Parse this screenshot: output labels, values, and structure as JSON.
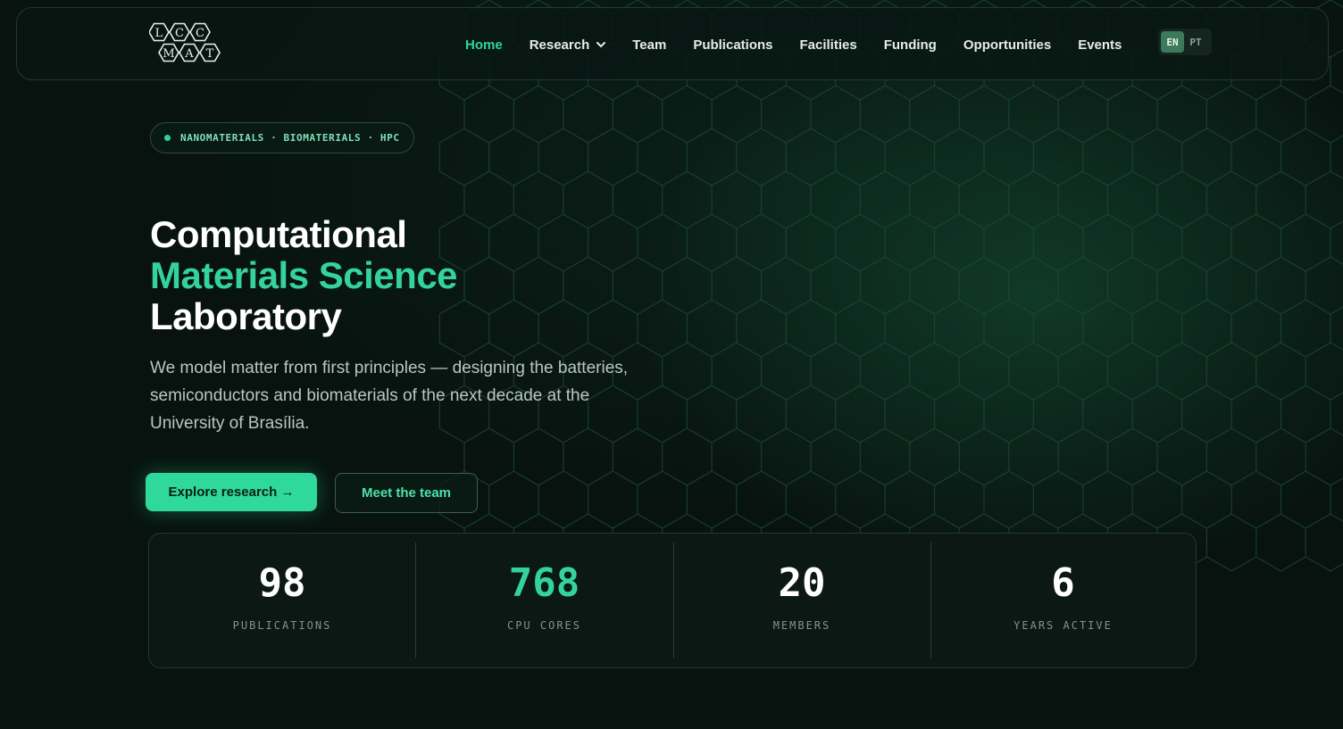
{
  "nav": {
    "logo_letters": [
      "L",
      "C",
      "C",
      "M",
      "A",
      "T"
    ],
    "links": [
      {
        "label": "Home",
        "active": true
      },
      {
        "label": "Research",
        "has_dropdown": true
      },
      {
        "label": "Team"
      },
      {
        "label": "Publications"
      },
      {
        "label": "Facilities"
      },
      {
        "label": "Funding"
      },
      {
        "label": "Opportunities"
      },
      {
        "label": "Events"
      }
    ],
    "languages": [
      {
        "code": "EN",
        "selected": true
      },
      {
        "code": "PT",
        "selected": false
      }
    ]
  },
  "hero": {
    "tags": "NANOMATERIALS · BIOMATERIALS · HPC",
    "title_line1": "Computational",
    "title_line2": "Materials Science",
    "title_line3": "Laboratory",
    "description": "We model matter from first principles — designing the batteries, semiconductors and biomaterials of the next decade at the University of Brasília.",
    "primary_button": "Explore research →",
    "secondary_button": "Meet the team"
  },
  "stats": [
    {
      "value": "98",
      "label": "PUBLICATIONS",
      "accent": false
    },
    {
      "value": "768",
      "label": "CPU CORES",
      "accent": true
    },
    {
      "value": "20",
      "label": "MEMBERS",
      "accent": false
    },
    {
      "value": "6",
      "label": "YEARS ACTIVE",
      "accent": false
    }
  ],
  "colors": {
    "background": "#08130f",
    "accent": "#34d39b",
    "primary_button": "#2fd89b"
  }
}
